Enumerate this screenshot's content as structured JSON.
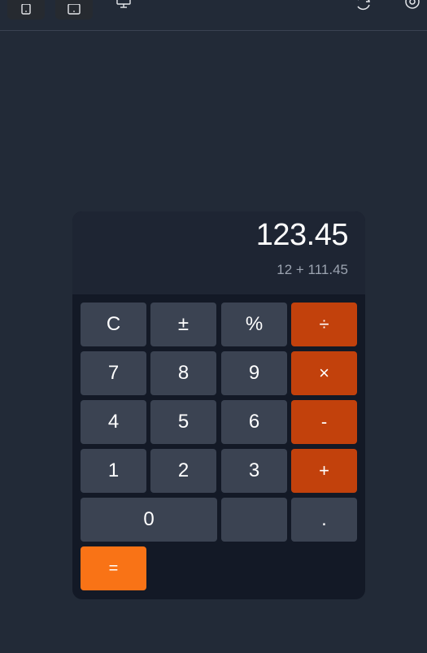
{
  "display": {
    "value": "123.45",
    "expression": "12 + 111.45"
  },
  "keypad": {
    "row1": [
      "C",
      "±",
      "%",
      "÷"
    ],
    "row2": [
      "7",
      "8",
      "9",
      "×"
    ],
    "row3": [
      "4",
      "5",
      "6",
      "-"
    ],
    "row4": [
      "1",
      "2",
      "3",
      "+"
    ],
    "row5": [
      "0",
      "",
      "."
    ],
    "row6": [
      "="
    ]
  },
  "colors": {
    "background": "#222a37",
    "panel": "#131926",
    "key": "#3b4352",
    "operator": "#c2410c",
    "equals": "#f97316"
  },
  "icons": {
    "toolbar": [
      "mobile-device-icon",
      "tablet-device-icon",
      "desktop-monitor-icon",
      "rotate-icon",
      "settings-icon"
    ]
  }
}
